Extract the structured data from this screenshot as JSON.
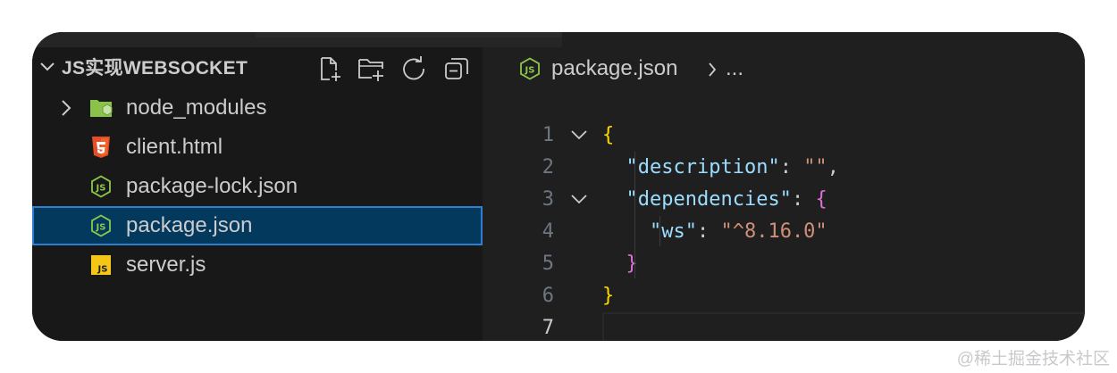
{
  "explorer": {
    "title": "JS实现WEBSOCKET",
    "header_actions": [
      "new-file-icon",
      "new-folder-icon",
      "refresh-icon",
      "collapse-all-icon"
    ],
    "items": [
      {
        "label": "node_modules",
        "type": "folder",
        "icon": "folder-icon",
        "collapsed": true
      },
      {
        "label": "client.html",
        "type": "file",
        "icon": "html5-icon"
      },
      {
        "label": "package-lock.json",
        "type": "file",
        "icon": "nodejs-icon"
      },
      {
        "label": "package.json",
        "type": "file",
        "icon": "nodejs-icon",
        "selected": true
      },
      {
        "label": "server.js",
        "type": "file",
        "icon": "js-icon"
      }
    ]
  },
  "breadcrumb": {
    "file": "package.json",
    "more": "..."
  },
  "editor": {
    "lines": [
      {
        "n": "1",
        "tokens": [
          {
            "t": "{",
            "c": "bracket1"
          }
        ]
      },
      {
        "n": "2",
        "tokens": [
          {
            "t": "  ",
            "c": "punc"
          },
          {
            "t": "\"description\"",
            "c": "key"
          },
          {
            "t": ": ",
            "c": "punc"
          },
          {
            "t": "\"\"",
            "c": "str"
          },
          {
            "t": ",",
            "c": "punc"
          }
        ]
      },
      {
        "n": "3",
        "tokens": [
          {
            "t": "  ",
            "c": "punc"
          },
          {
            "t": "\"dependencies\"",
            "c": "key"
          },
          {
            "t": ": ",
            "c": "punc"
          },
          {
            "t": "{",
            "c": "bracket2"
          }
        ]
      },
      {
        "n": "4",
        "tokens": [
          {
            "t": "    ",
            "c": "punc"
          },
          {
            "t": "\"ws\"",
            "c": "key"
          },
          {
            "t": ": ",
            "c": "punc"
          },
          {
            "t": "\"^8.16.0\"",
            "c": "str"
          }
        ]
      },
      {
        "n": "5",
        "tokens": [
          {
            "t": "  ",
            "c": "punc"
          },
          {
            "t": "}",
            "c": "bracket2"
          }
        ]
      },
      {
        "n": "6",
        "tokens": [
          {
            "t": "}",
            "c": "bracket1"
          }
        ]
      },
      {
        "n": "7",
        "tokens": []
      }
    ],
    "active_line": "7"
  },
  "colors": {
    "sidebar_bg": "#181818",
    "editor_bg": "#1f1f1f",
    "selection": "#04395e",
    "selection_border": "#2f7fd0",
    "json_key": "#9cdcfe",
    "json_string": "#ce9178",
    "bracket_level1": "#ffd700",
    "bracket_level2": "#da70d6"
  },
  "watermark": "@稀土掘金技术社区"
}
